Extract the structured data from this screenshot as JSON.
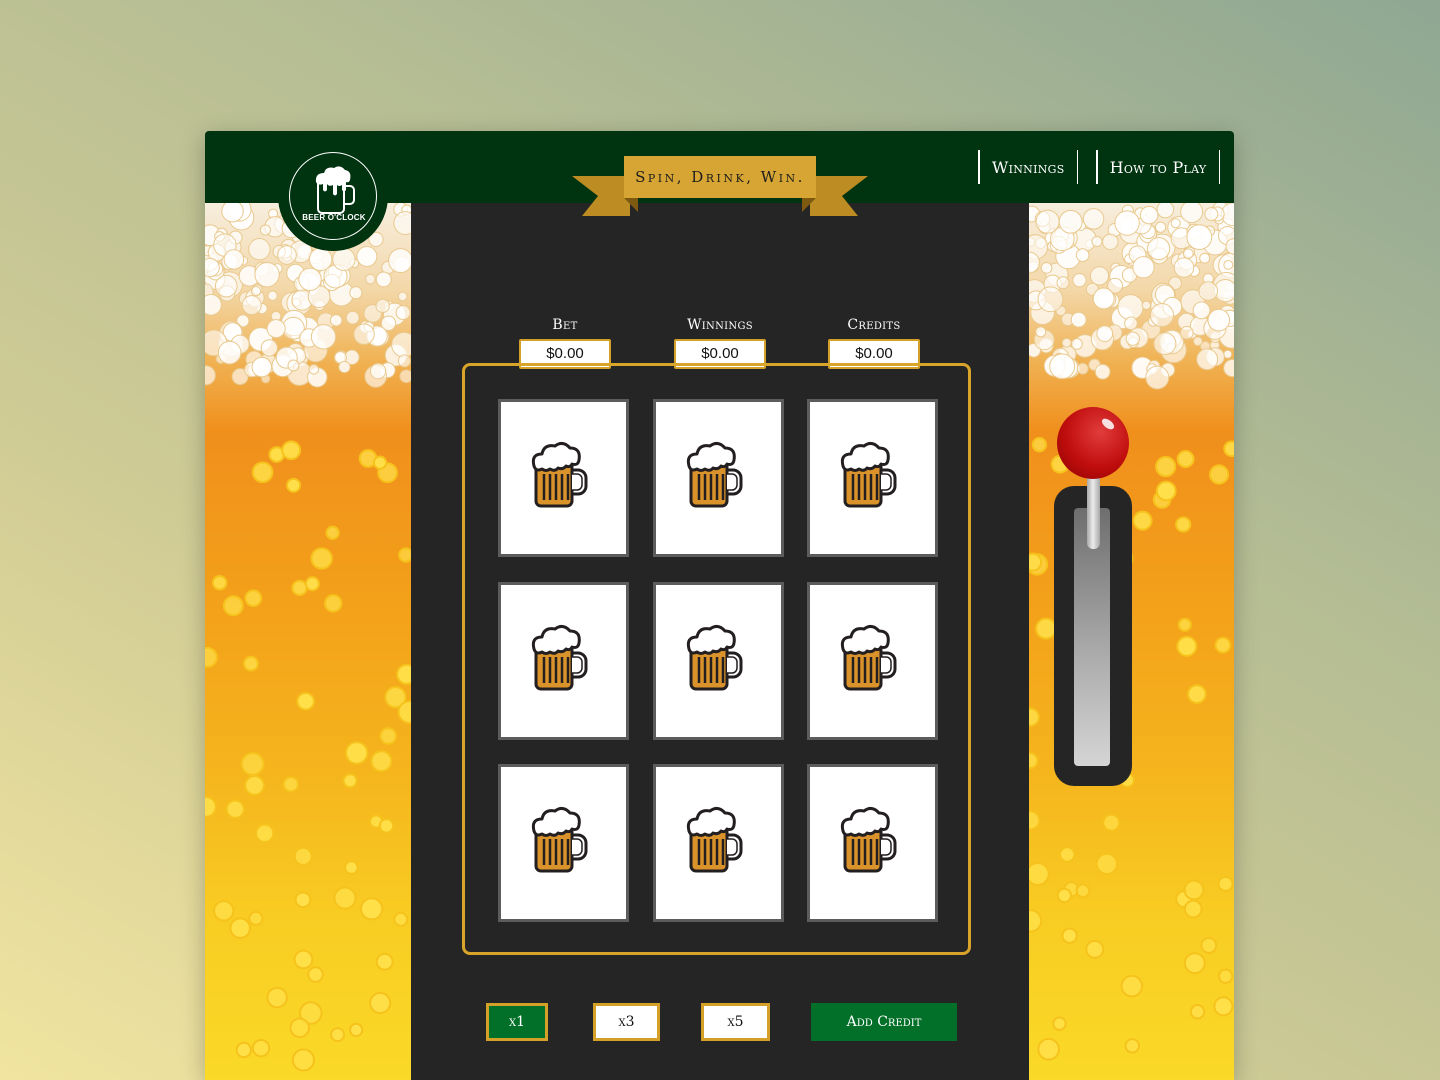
{
  "app": {
    "logo_text": "BEER O'CLOCK"
  },
  "nav": {
    "items": [
      {
        "label": "Winnings"
      },
      {
        "label": "How to Play"
      }
    ]
  },
  "banner": {
    "text": "Spin, Drink, Win."
  },
  "stats": [
    {
      "label": "Bet",
      "value": "$0.00"
    },
    {
      "label": "Winnings",
      "value": "$0.00"
    },
    {
      "label": "Credits",
      "value": "$0.00"
    }
  ],
  "reels": [
    [
      "beer-mug-icon",
      "beer-mug-icon",
      "beer-mug-icon"
    ],
    [
      "beer-mug-icon",
      "beer-mug-icon",
      "beer-mug-icon"
    ],
    [
      "beer-mug-icon",
      "beer-mug-icon",
      "beer-mug-icon"
    ]
  ],
  "controls": {
    "multipliers": [
      {
        "label": "x1",
        "selected": true
      },
      {
        "label": "x3",
        "selected": false
      },
      {
        "label": "x5",
        "selected": false
      }
    ],
    "add_credit_label": "Add Credit"
  },
  "lever": {
    "icon": "slot-lever-icon"
  },
  "colors": {
    "header_green": "#00330f",
    "button_green": "#037029",
    "gold": "#d4a027",
    "panel_dark": "#252525",
    "lever_red": "#c00d0d"
  }
}
